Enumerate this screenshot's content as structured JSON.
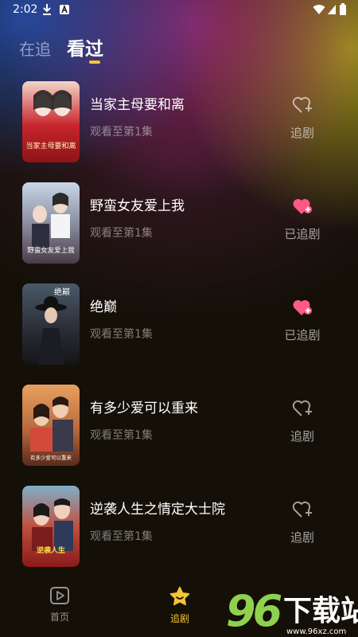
{
  "status_bar": {
    "time": "2:02",
    "icons_left": [
      "download-icon",
      "a-app-icon"
    ],
    "icons_right": [
      "wifi-icon",
      "signal-icon",
      "battery-icon"
    ]
  },
  "tabs": [
    {
      "label": "在追",
      "active": false
    },
    {
      "label": "看过",
      "active": true
    }
  ],
  "items": [
    {
      "title": "当家主母要和离",
      "progress": "观看至第1集",
      "follow_label": "追剧",
      "followed": false,
      "poster_text": "当家主母要和离"
    },
    {
      "title": "野蛮女友爱上我",
      "progress": "观看至第1集",
      "follow_label": "已追剧",
      "followed": true,
      "poster_text": "野蛮女友爱上我"
    },
    {
      "title": "绝巅",
      "progress": "观看至第1集",
      "follow_label": "已追剧",
      "followed": true,
      "poster_text": "绝巅"
    },
    {
      "title": "有多少爱可以重来",
      "progress": "观看至第1集",
      "follow_label": "追剧",
      "followed": false,
      "poster_text": "有多少爱可以重来"
    },
    {
      "title": "逆袭人生之情定大士院",
      "progress": "观看至第1集",
      "follow_label": "追剧",
      "followed": false,
      "poster_text": "逆袭人生"
    }
  ],
  "bottom_nav": [
    {
      "label": "首页",
      "icon": "play-square-icon",
      "active": false
    },
    {
      "label": "追剧",
      "icon": "star-icon",
      "active": true
    }
  ],
  "watermark": {
    "number": "96",
    "text": "下载站",
    "url": "www.96xz.com"
  },
  "colors": {
    "accent": "#f4c534",
    "followed_heart": "#ff5a87",
    "muted_text": "#8a8a8a"
  }
}
